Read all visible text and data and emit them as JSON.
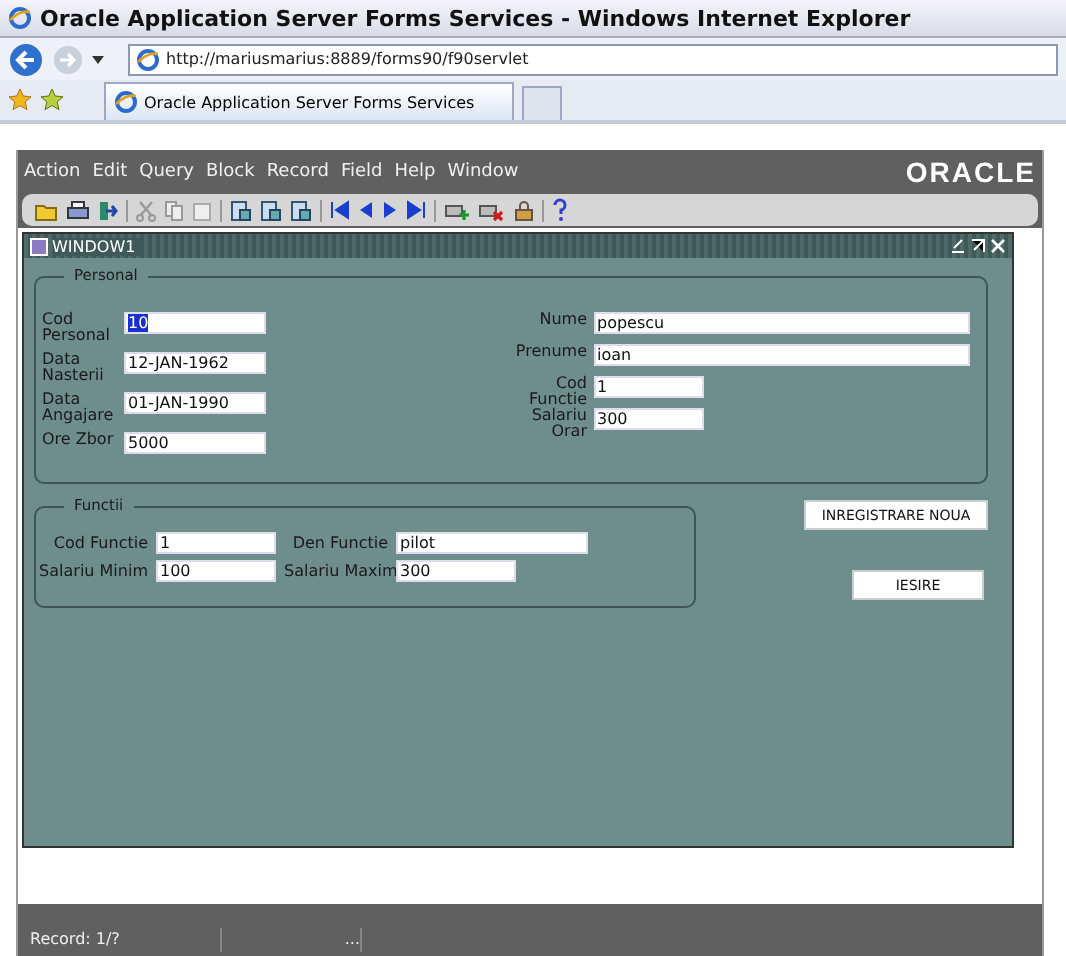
{
  "browser": {
    "title": "Oracle Application Server Forms Services - Windows Internet Explorer",
    "address": "http://mariusmarius:8889/forms90/f90servlet",
    "tab": "Oracle Application Server Forms Services"
  },
  "menu": [
    "Action",
    "Edit",
    "Query",
    "Block",
    "Record",
    "Field",
    "Help",
    "Window"
  ],
  "brand": "ORACLE",
  "window": {
    "title": "WINDOW1"
  },
  "personal": {
    "legend": "Personal",
    "left": [
      {
        "label": "Cod Personal",
        "value": "10",
        "selected": true,
        "kind": "narrow"
      },
      {
        "label": "Data Nasterii",
        "value": "12-JAN-1962",
        "selected": false,
        "kind": "narrow"
      },
      {
        "label": "Data Angajare",
        "value": "01-JAN-1990",
        "selected": false,
        "kind": "narrow"
      },
      {
        "label": "Ore Zbor",
        "value": "5000",
        "selected": false,
        "kind": "narrow"
      }
    ],
    "right": [
      {
        "label": "Nume",
        "value": "popescu",
        "selected": false,
        "kind": "wide"
      },
      {
        "label": "Prenume",
        "value": "ioan",
        "selected": false,
        "kind": "wide"
      },
      {
        "label": "Cod Functie",
        "value": "1",
        "selected": false,
        "kind": "narrow"
      },
      {
        "label": "Salariu Orar",
        "value": "300",
        "selected": false,
        "kind": "narrow"
      }
    ]
  },
  "functii": {
    "legend": "Functii",
    "fields": [
      {
        "label": "Cod Functie",
        "value": "1",
        "kind": "narrow"
      },
      {
        "label": "Den Functie",
        "value": "pilot",
        "kind": "wide"
      },
      {
        "label": "Salariu Minim",
        "value": "100",
        "kind": "narrow"
      },
      {
        "label": "Salariu Maxim",
        "value": "300",
        "kind": "narrow"
      }
    ]
  },
  "buttons": [
    "INREGISTRARE NOUA",
    "IESIRE"
  ],
  "status_bar": [
    "Record: 1/?",
    "..."
  ]
}
